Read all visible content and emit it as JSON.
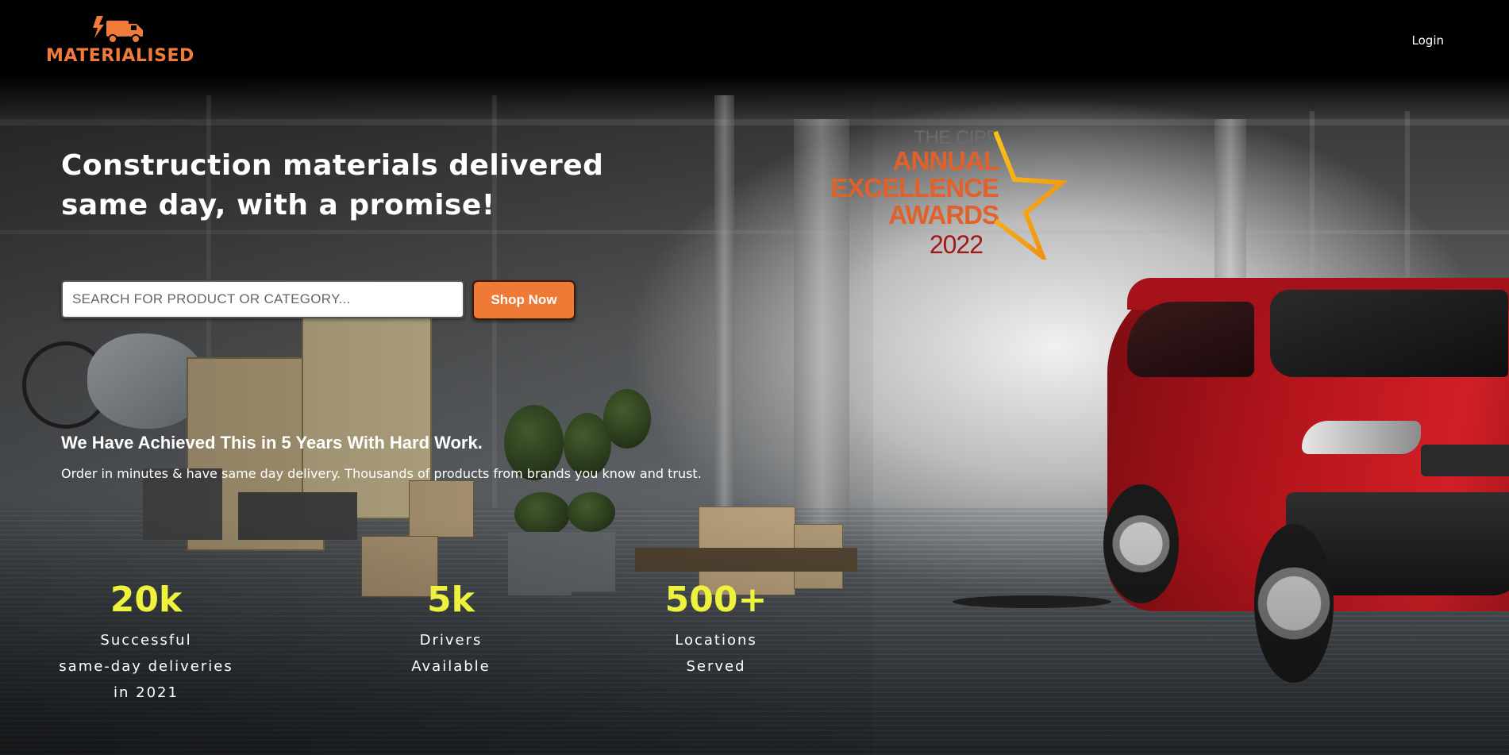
{
  "header": {
    "logo_text": "MATERIALISED",
    "logo_icon": "delivery-truck-bolt-icon",
    "login_label": "Login"
  },
  "hero": {
    "headline": "Construction materials delivered same day, with a promise!",
    "search": {
      "placeholder": "SEARCH FOR PRODUCT OR CATEGORY...",
      "value": ""
    },
    "shop_button_label": "Shop Now"
  },
  "award": {
    "line1": "THE CIPP",
    "line2": "ANNUAL",
    "line3": "EXCELLENCE",
    "line4": "AWARDS",
    "line5": "2022"
  },
  "achievement": {
    "title": "We Have Achieved This in 5 Years With Hard Work.",
    "description": "Order in minutes & have same day delivery. Thousands of products from brands you know and trust."
  },
  "stats": [
    {
      "value": "20k",
      "label": "Successful\nsame-day deliveries\nin 2021"
    },
    {
      "value": "5k",
      "label": "Drivers\nAvailable"
    },
    {
      "value": "500+",
      "label": "Locations\nServed"
    }
  ],
  "colors": {
    "brand_orange": "#f07b3a",
    "button_orange": "#ef7a36",
    "stat_yellow": "#eef23d",
    "van_red": "#c8161e"
  }
}
